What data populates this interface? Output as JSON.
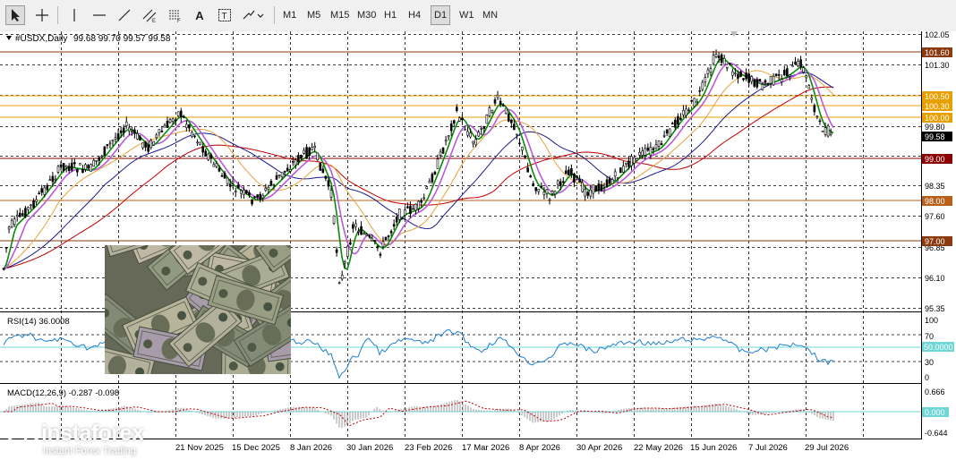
{
  "toolbar": {
    "tools": [
      {
        "name": "cursor-tool",
        "icon": "cursor-icon"
      },
      {
        "name": "crosshair-tool",
        "icon": "crosshair-icon"
      },
      {
        "name": "vertical-line-tool",
        "icon": "vertical-line-icon"
      },
      {
        "name": "horizontal-line-tool",
        "icon": "horizontal-line-icon"
      },
      {
        "name": "trendline-tool",
        "icon": "trendline-icon"
      },
      {
        "name": "equidistant-channel-tool",
        "icon": "channel-icon"
      },
      {
        "name": "fibonacci-tool",
        "icon": "fibonacci-icon"
      },
      {
        "name": "text-tool",
        "icon": "text-icon",
        "label": "A"
      },
      {
        "name": "text-label-tool",
        "icon": "text-label-icon"
      },
      {
        "name": "arrows-tool",
        "icon": "arrows-icon"
      }
    ],
    "timeframes": [
      "M1",
      "M5",
      "M15",
      "M30",
      "H1",
      "H4",
      "D1",
      "W1",
      "MN"
    ],
    "active_timeframe": "D1"
  },
  "chart_header": {
    "symbol": "#USDX,Daily",
    "ohlc": "99.68 99.70 99.57 99.58"
  },
  "price_axis": {
    "ticks": [
      "102.05",
      "101.30",
      "100.50",
      "100.30",
      "99.80",
      "99.00",
      "98.35",
      "97.60",
      "96.85",
      "96.10",
      "95.35"
    ],
    "current_price": "99.58",
    "highlighted_levels": [
      {
        "label": "101.60",
        "color": "#8B3A0E"
      },
      {
        "label": "100.50",
        "color": "#E8A000"
      },
      {
        "label": "100.30",
        "color": "#E8A000"
      },
      {
        "label": "100.00",
        "color": "#E8A000"
      },
      {
        "label": "99.00",
        "color": "#8B0000"
      },
      {
        "label": "98.00",
        "color": "#B8601A"
      },
      {
        "label": "97.00",
        "color": "#8B3A0E"
      }
    ]
  },
  "rsi_panel": {
    "label": "RSI(14) 36.0008",
    "axis_ticks": [
      "100",
      "70",
      "50",
      "30",
      "0"
    ],
    "current_level_label": "50.0000"
  },
  "macd_panel": {
    "label": "MACD(12,26,9) -0.287 -0.098",
    "axis_ticks": [
      "0.666",
      "-0.644"
    ],
    "zero_label": "0.000"
  },
  "time_axis": {
    "labels": [
      "21 Nov 2025",
      "15 Dec 2025",
      "8 Jan 2026",
      "30 Jan 2026",
      "23 Feb 2026",
      "17 Mar 2026",
      "8 Apr 2026",
      "30 Apr 2026",
      "22 May 2026",
      "15 Jun 2026",
      "7 Jul 2026",
      "29 Jul 2026"
    ]
  },
  "watermark": {
    "brand": "instaforex",
    "tagline": "Instant Forex Trading"
  },
  "colors": {
    "bull_candle": "#000000",
    "ma_fast": "#0a8a0a",
    "ma_medium": "#b95bd8",
    "ma_slow_orange": "#e6a23c",
    "ma_long_navy": "#1a1a8c",
    "ma_long_red": "#c00000",
    "rsi_line": "#1e7fd0",
    "macd_signal": "#c00000",
    "macd_hist": "#9a9a9a"
  }
}
